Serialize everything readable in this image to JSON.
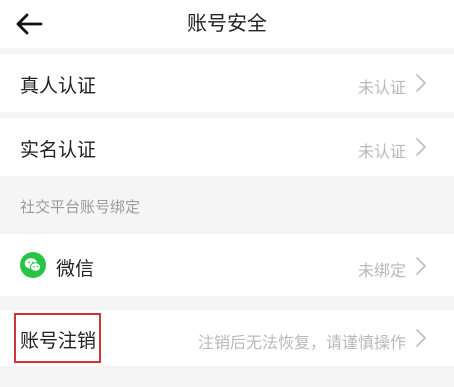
{
  "header": {
    "title": "账号安全",
    "back_icon": "arrow-left-icon"
  },
  "rows": {
    "real_person": {
      "label": "真人认证",
      "value": "未认证"
    },
    "real_name": {
      "label": "实名认证",
      "value": "未认证"
    },
    "social_section_title": "社交平台账号绑定",
    "wechat": {
      "icon": "wechat-icon",
      "label": "微信",
      "value": "未绑定"
    },
    "cancel_account": {
      "label": "账号注销",
      "value": "注销后无法恢复，请谨慎操作"
    }
  },
  "colors": {
    "wechat_green": "#28c445",
    "highlight_red": "#d0343a",
    "muted_text": "#b9b9b9",
    "section_bg": "#f5f5f5"
  }
}
